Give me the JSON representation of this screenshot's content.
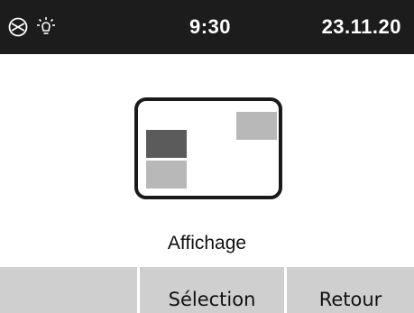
{
  "status_bar": {
    "icons": [
      "timer-off-icon",
      "light-bulb-icon"
    ],
    "time": "9:30",
    "date": "23.11.20"
  },
  "screen": {
    "title": "Affichage",
    "preview_icon": "display-layout-icon"
  },
  "softkeys": {
    "left_label": "",
    "middle_label": "Sélection",
    "right_label": "Retour"
  },
  "colors": {
    "status_bar_bg": "#1c1c1c",
    "softkey_bg": "#cfcfcf",
    "tile_dark": "#5b5b5b",
    "tile_light": "#b8b8b8"
  }
}
